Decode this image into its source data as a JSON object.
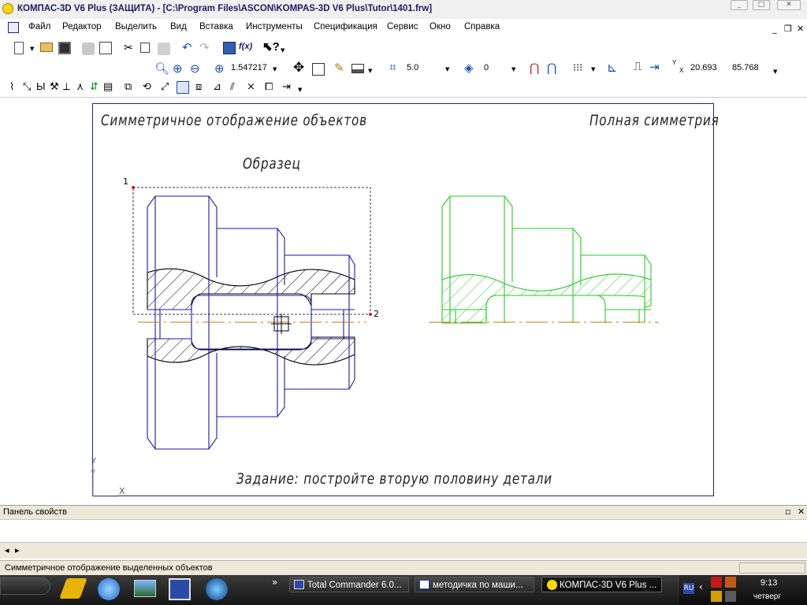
{
  "window": {
    "title": "КОМПАС-3D V6 Plus (ЗАЩИТА) - [C:\\Program Files\\ASCON\\KOMPAS-3D V6 Plus\\Tutor\\1401.frw]",
    "minimize_glyph": "_",
    "maximize_glyph": "□",
    "close_glyph": "✕"
  },
  "menu": {
    "items": [
      "Файл",
      "Редактор",
      "Выделить",
      "Вид",
      "Вставка",
      "Инструменты",
      "Спецификация",
      "Сервис",
      "Окно",
      "Справка"
    ],
    "doc_min": "_",
    "doc_restore": "❐",
    "doc_close": "✕"
  },
  "toolbar": {
    "zoom_value": "1.547217",
    "step_value": "5.0",
    "layer_value": "0",
    "coord_x": "20.693",
    "coord_y": "85.768",
    "fx_label": "f(x)",
    "axis_y": "Y",
    "axis_x": "X",
    "icons": [
      "new-document-icon",
      "open-icon",
      "save-icon",
      "cut-icon",
      "copy-icon",
      "paste-icon",
      "undo-icon",
      "redo-icon",
      "calculator-icon",
      "help-cursor-icon",
      "zoom-icon",
      "zoom-in-icon",
      "zoom-out-icon",
      "pan-icon",
      "fit-icon",
      "snap-icon",
      "grid-icon",
      "coordinates-icon"
    ]
  },
  "drawing": {
    "header_left": "Симметричное отображение объектов",
    "header_right": "Полная симметрия",
    "sample_label": "Образец",
    "point1_label": "1",
    "point2_label": "2",
    "task_text": "Задание: постройте вторую половину детали",
    "axis_y_label": "Y",
    "axis_x_label": "X",
    "colors": {
      "sample": "#1a1aa8",
      "result": "#22cc22",
      "axis": "#cc7700",
      "frame": "#1d1d99",
      "point": "#cc2222"
    }
  },
  "panel": {
    "title": "Панель свойств",
    "pin_glyph": "▫",
    "close_glyph": "✕",
    "nav_left": "◂",
    "nav_right": "▸"
  },
  "status": {
    "text": "Симметричное отображение выделенных объектов"
  },
  "taskbar": {
    "expand_glyph": "»",
    "tasks": [
      {
        "label": "Total Commander 6.0...",
        "icon": "floppy-icon"
      },
      {
        "label": "методичка по маши...",
        "icon": "word-icon"
      },
      {
        "label": "КОМПАС-3D V6 Plus ...",
        "icon": "kompas-icon"
      }
    ],
    "language": "RU",
    "time": "9:13",
    "day": "четверг"
  }
}
